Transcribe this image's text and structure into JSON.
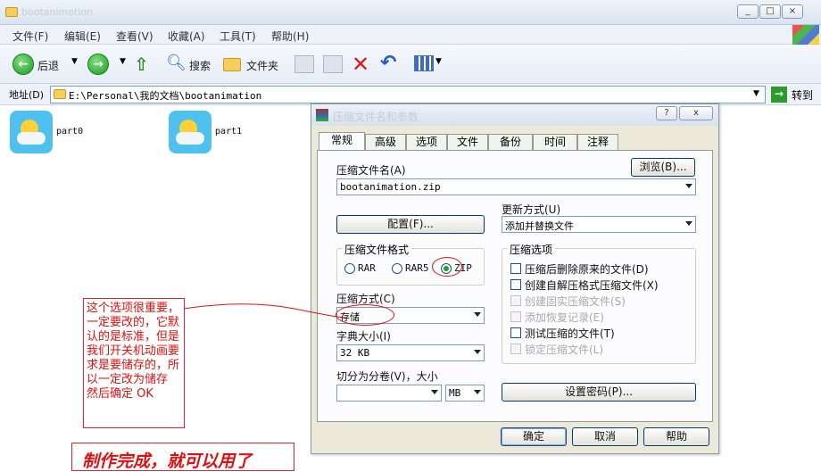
{
  "window": {
    "title": "bootanimation"
  },
  "menu": [
    "文件(F)",
    "编辑(E)",
    "查看(V)",
    "收藏(A)",
    "工具(T)",
    "帮助(H)"
  ],
  "toolbar": {
    "back": "后退",
    "search": "搜索",
    "folders": "文件夹"
  },
  "address": {
    "label": "地址(D)",
    "path": "E:\\Personal\\我的文档\\bootanimation",
    "go": "转到"
  },
  "files": [
    {
      "name": "part0"
    },
    {
      "name": "part1"
    }
  ],
  "dialog": {
    "title": "压缩文件名和参数",
    "tabs": [
      "常规",
      "高级",
      "选项",
      "文件",
      "备份",
      "时间",
      "注释"
    ],
    "archive_name_label": "压缩文件名(A)",
    "browse_btn": "浏览(B)...",
    "archive_name": "bootanimation.zip",
    "update_mode_label": "更新方式(U)",
    "update_mode": "添加并替换文件",
    "config_btn": "配置(F)...",
    "format_group": "压缩文件格式",
    "formats": [
      "RAR",
      "RAR5",
      "ZIP"
    ],
    "selected_format": "ZIP",
    "method_label": "压缩方式(C)",
    "method": "存储",
    "dict_label": "字典大小(I)",
    "dict": "32 KB",
    "split_label": "切分为分卷(V)，大小",
    "split_unit": "MB",
    "options_group": "压缩选项",
    "options": [
      {
        "label": "压缩后删除原来的文件(D)",
        "enabled": true
      },
      {
        "label": "创建自解压格式压缩文件(X)",
        "enabled": true
      },
      {
        "label": "创建固实压缩文件(S)",
        "enabled": false
      },
      {
        "label": "添加恢复记录(E)",
        "enabled": false
      },
      {
        "label": "测试压缩的文件(T)",
        "enabled": true
      },
      {
        "label": "锁定压缩文件(L)",
        "enabled": false
      }
    ],
    "password_btn": "设置密码(P)...",
    "ok": "确定",
    "cancel": "取消",
    "help": "帮助",
    "help_icon": "?",
    "close_icon": "x"
  },
  "annotations": {
    "note": "这个选项很重要，一定要改的，它默认的是标准，但是我们开关机动画要求是要储存的，所以一定改为储存\n然后确定 OK",
    "done": "制作完成，就可以用了"
  }
}
